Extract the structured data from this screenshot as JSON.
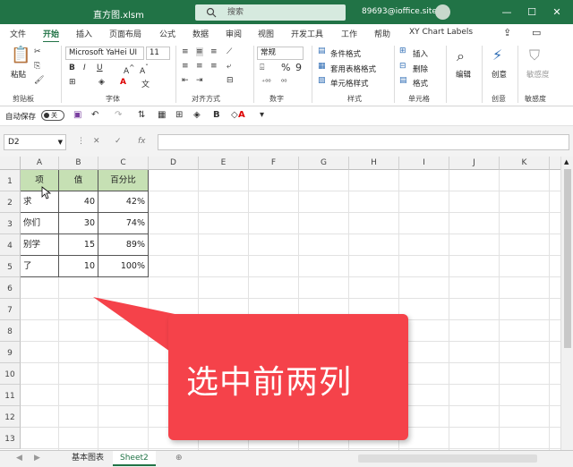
{
  "window": {
    "filename": "直方图.xlsm",
    "search_placeholder": "搜索",
    "user": "89693@ioffice.site",
    "buttons": [
      "—",
      "☐",
      "✕"
    ]
  },
  "tabs": [
    "文件",
    "开始",
    "插入",
    "页面布局",
    "公式",
    "数据",
    "审阅",
    "视图",
    "开发工具",
    "工作",
    "帮助",
    "XY Chart Labels"
  ],
  "active_tab": "开始",
  "ribbon": {
    "clipboard": {
      "paste_label": "粘贴",
      "group": "剪贴板"
    },
    "font": {
      "name": "Microsoft YaHei UI",
      "size": "11",
      "group": "字体"
    },
    "alignment": {
      "group": "对齐方式"
    },
    "number": {
      "format": "常规",
      "group": "数字"
    },
    "styles": {
      "conditional": "条件格式",
      "table": "套用表格格式",
      "cell": "单元格样式",
      "group": "样式"
    },
    "cells": {
      "insert": "插入",
      "delete": "删除",
      "format": "格式",
      "group": "单元格"
    },
    "editing": {
      "label": "编辑"
    },
    "ideas": {
      "label": "创意",
      "group": "创意"
    },
    "sensitivity": {
      "label": "敏感度",
      "group": "敏感度"
    }
  },
  "qat": {
    "autosave": "自动保存",
    "toggle": "关"
  },
  "formula_bar": {
    "namebox": "D2",
    "content": ""
  },
  "grid": {
    "columns": [
      "A",
      "B",
      "C",
      "D",
      "E",
      "F",
      "G",
      "H",
      "I",
      "J",
      "K"
    ],
    "rows": [
      "1",
      "2",
      "3",
      "4",
      "5",
      "6",
      "7",
      "8",
      "9",
      "10",
      "11",
      "12",
      "13"
    ],
    "header_row": [
      "项",
      "值",
      "百分比"
    ],
    "data": [
      [
        "求",
        "40",
        "42%"
      ],
      [
        "你们",
        "30",
        "74%"
      ],
      [
        "别学",
        "15",
        "89%"
      ],
      [
        "了",
        "10",
        "100%"
      ]
    ]
  },
  "sheets": [
    "基本图表",
    "Sheet2"
  ],
  "active_sheet": "Sheet2",
  "callout": {
    "text": "选中前两列",
    "color": "#f5424a"
  },
  "colors": {
    "brand": "#217346",
    "header_fill": "#c6e0b4"
  }
}
